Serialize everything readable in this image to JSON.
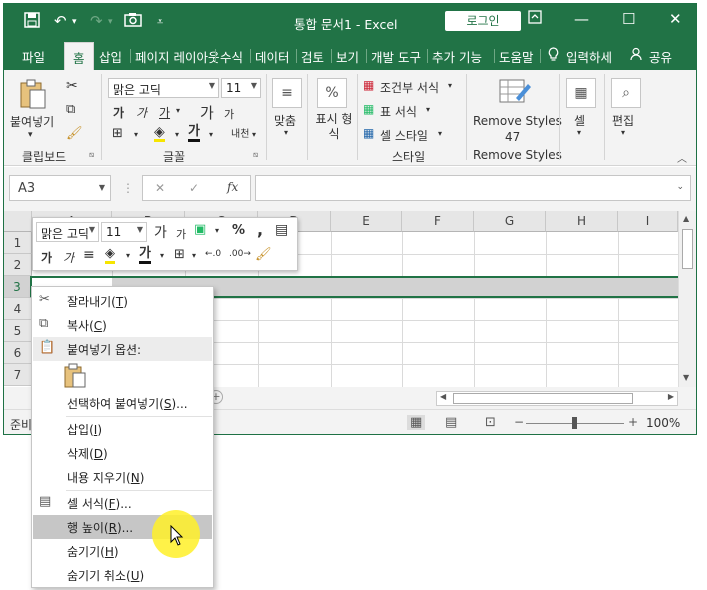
{
  "titlebar": {
    "title": "통합 문서1  -  Excel",
    "login_label": "로그인",
    "save_icon": "save-icon",
    "undo_icon": "undo-icon",
    "redo_icon": "redo-icon",
    "camera_icon": "camera-icon",
    "customize_icon": "qat-customize-icon"
  },
  "tabs": [
    "파일",
    "홈",
    "삽입",
    "페이지 레이아웃",
    "수식",
    "데이터",
    "검토",
    "보기",
    "개발 도구",
    "추가 기능",
    "도움말"
  ],
  "tell_me": "입력하세",
  "share": "공유",
  "ribbon": {
    "clipboard": {
      "paste": "붙여넣기",
      "group": "클립보드"
    },
    "font": {
      "name": "맑은 고딕",
      "size": "11",
      "group": "글꼴",
      "bold": "가",
      "italic": "가",
      "underline": "가",
      "grow": "가",
      "shrink": "가",
      "color": "가",
      "phonetic": "내천"
    },
    "align": {
      "label": "맞춤"
    },
    "number": {
      "label": "표시 형식",
      "symbol": "%"
    },
    "styles": {
      "cond": "조건부 서식",
      "table": "표 서식",
      "cell": "셀 스타일",
      "group": "스타일"
    },
    "remove": {
      "label": "Remove Styles",
      "count": "47",
      "group": "Remove Styles"
    },
    "cells": {
      "label": "셀"
    },
    "edit": {
      "label": "편집"
    }
  },
  "formula": {
    "namebox": "A3",
    "cancel": "✕",
    "enter": "✓",
    "fx": "fx",
    "value": ""
  },
  "grid": {
    "columns": [
      "A",
      "B",
      "C",
      "D",
      "E",
      "F",
      "G",
      "H",
      "I"
    ],
    "rows": [
      "1",
      "2",
      "3",
      "4",
      "5",
      "6",
      "7"
    ],
    "selected_row": "3"
  },
  "status": {
    "ready": "준비",
    "zoom": "100%",
    "minus": "−",
    "plus": "+"
  },
  "minitoolbar": {
    "font": "맑은 고딕",
    "size": "11",
    "percent": "%",
    "comma": ","
  },
  "context_menu": {
    "cut": {
      "text": "잘라내기(",
      "key": "T",
      "end": ")"
    },
    "copy": {
      "text": "복사(",
      "key": "C",
      "end": ")"
    },
    "paste_options": "붙여넣기 옵션:",
    "paste_special": {
      "text": "선택하여 붙여넣기(",
      "key": "S",
      "end": ")..."
    },
    "insert": {
      "text": "삽입(",
      "key": "I",
      "end": ")"
    },
    "delete": {
      "text": "삭제(",
      "key": "D",
      "end": ")"
    },
    "clear": {
      "text": "내용 지우기(",
      "key": "N",
      "end": ")"
    },
    "format_cells": {
      "text": "셀 서식(",
      "key": "F",
      "end": ")..."
    },
    "row_height": {
      "text": "행 높이(",
      "key": "R",
      "end": ")..."
    },
    "hide": {
      "text": "숨기기(",
      "key": "H",
      "end": ")"
    },
    "unhide": {
      "text": "숨기기 취소(",
      "key": "U",
      "end": ")"
    }
  },
  "colors": {
    "accent": "#217346",
    "highlight": "#c6c6c6"
  }
}
